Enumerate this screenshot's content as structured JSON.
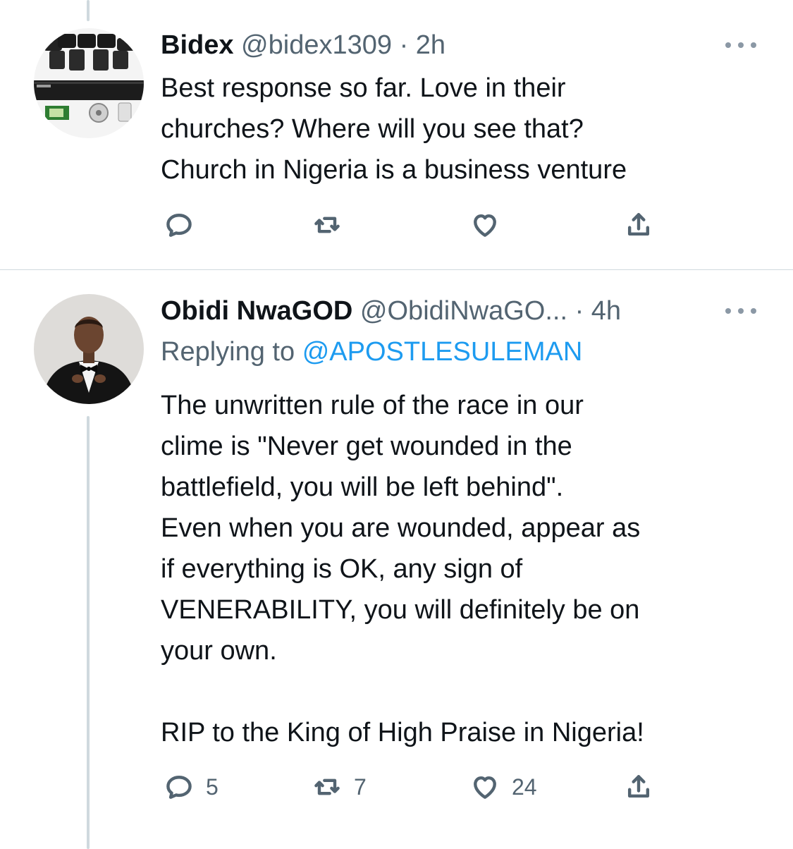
{
  "tweets": [
    {
      "name": "Bidex",
      "handle": "@bidex1309",
      "separator": "·",
      "time": "2h",
      "avatar": "dvr-security-camera-avatar",
      "text": "Best response so far. Love in their\nchurches? Where will you see that?\nChurch in Nigeria is a business venture",
      "actions": {
        "reply_count": "",
        "retweet_count": "",
        "like_count": ""
      }
    },
    {
      "name": "Obidi NwaGOD",
      "handle": "@ObidiNwaGO...",
      "separator": "·",
      "time": "4h",
      "avatar": "man-in-tuxedo-avatar",
      "reply_prefix": "Replying to",
      "reply_mention": "@APOSTLESULEMAN",
      "text": "The unwritten rule of the race in our\nclime is \"Never get wounded in the\nbattlefield, you will be left behind\".\nEven when you are wounded, appear as\nif everything is OK, any sign of\nVENERABILITY, you will definitely be on\nyour own.\n\nRIP to the King of High Praise in Nigeria!",
      "actions": {
        "reply_count": "5",
        "retweet_count": "7",
        "like_count": "24"
      }
    }
  ],
  "colors": {
    "text": "#0f1419",
    "secondary": "#536471",
    "link": "#1d9bf0",
    "divider": "#cfd9de"
  },
  "icons": [
    "reply-icon",
    "retweet-icon",
    "like-icon",
    "share-icon",
    "more-icon"
  ]
}
